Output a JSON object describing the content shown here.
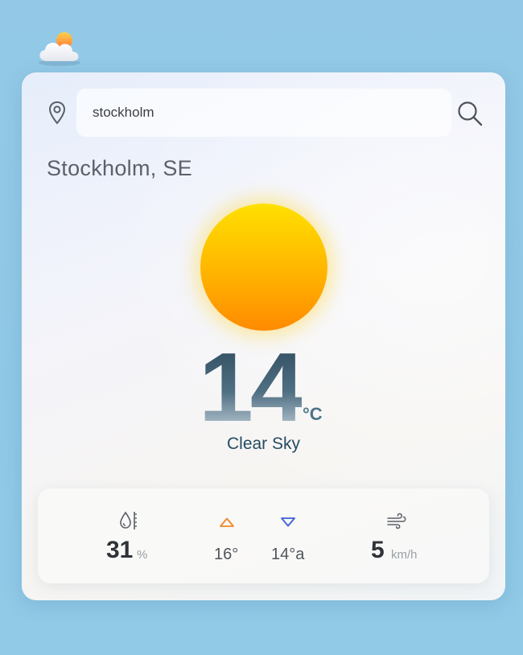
{
  "app": {
    "logo_icon": "partly-cloudy-icon"
  },
  "search": {
    "value": "stockholm",
    "placeholder": "",
    "location_icon": "map-pin-icon",
    "search_icon": "search-icon"
  },
  "weather": {
    "city": "Stockholm, SE",
    "condition_icon": "sun-icon",
    "temperature": "14",
    "unit": "°C",
    "condition": "Clear Sky"
  },
  "stats": {
    "humidity": {
      "icon": "humidity-icon",
      "value": "31",
      "unit": "%"
    },
    "max": {
      "icon": "triangle-up-icon",
      "value": "16°"
    },
    "min": {
      "icon": "triangle-down-icon",
      "value": "14°a"
    },
    "wind": {
      "icon": "wind-icon",
      "value": "5",
      "unit": "km/h"
    }
  },
  "colors": {
    "background": "#93c9e6",
    "sun_top": "#ffe000",
    "sun_bottom": "#ff8a00",
    "up_arrow": "#f0882a",
    "down_arrow": "#3b62d6",
    "condition_text": "#244b63"
  }
}
